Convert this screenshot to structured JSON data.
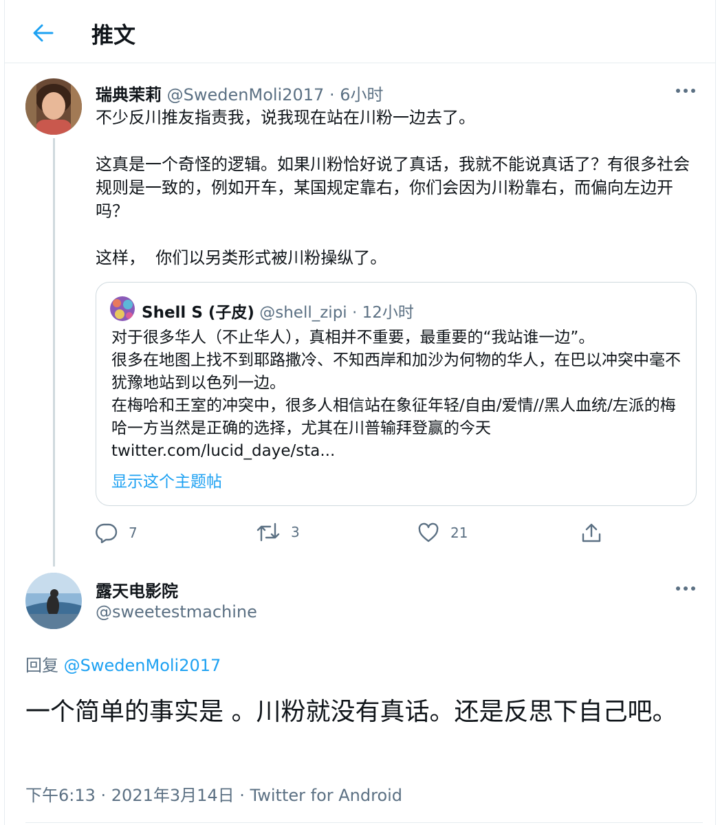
{
  "header": {
    "title": "推文"
  },
  "tweet": {
    "display_name": "瑞典茉莉",
    "handle": "@SwedenMoli2017",
    "dot": "·",
    "time": "6小时",
    "text": "不少反川推友指责我，说我现在站在川粉一边去了。\n\n这真是一个奇怪的逻辑。如果川粉恰好说了真话，我就不能说真话了？有很多社会规则是一致的，例如开车，某国规定靠右，你们会因为川粉靠右，而偏向左边开吗？\n\n这样，  你们以另类形式被川粉操纵了。",
    "quote": {
      "display_name": "Shell S (子皮)",
      "handle": "@shell_zipi",
      "dot": "·",
      "time": "12小时",
      "text": "对于很多华人（不止华人），真相并不重要，最重要的“我站谁一边”。\n很多在地图上找不到耶路撒冷、不知西岸和加沙为何物的华人，在巴以冲突中毫不犹豫地站到以色列一边。\n在梅哈和王室的冲突中，很多人相信站在象征年轻/自由/爱情//黑人血统/左派的梅哈一方当然是正确的选择，尤其在川普输拜登赢的今天\ntwitter.com/lucid_daye/sta...",
      "show_thread": "显示这个主题帖"
    },
    "actions": {
      "replies": "7",
      "retweets": "3",
      "likes": "21"
    }
  },
  "reply": {
    "display_name": "露天电影院",
    "handle": "@sweetestmachine",
    "replying_to_prefix": "回复",
    "replying_to_handle": "@SwedenMoli2017",
    "text": "一个简单的事实是 。川粉就没有真话。还是反思下自己吧。",
    "timestamp": "下午6:13 · 2021年3月14日 · Twitter for Android"
  },
  "colors": {
    "accent": "#1da1f2",
    "secondary": "#5b7083",
    "border": "#e6ecf0"
  },
  "icons": [
    "back-arrow-icon",
    "more-icon",
    "reply-icon",
    "retweet-icon",
    "like-icon",
    "share-icon"
  ]
}
